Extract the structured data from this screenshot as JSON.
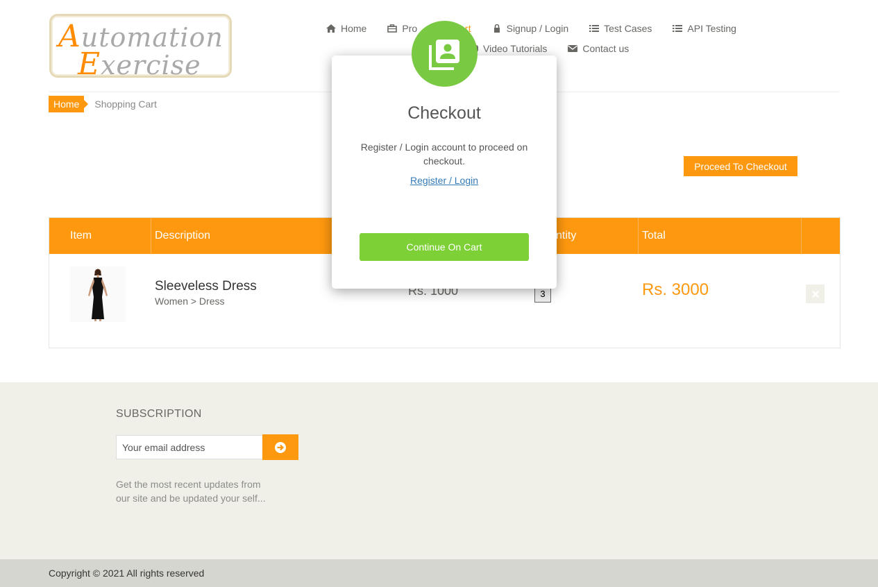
{
  "logo": {
    "line1_cap": "A",
    "line1_rest": "utomation",
    "line2_cap": "E",
    "line2_rest": "xercise"
  },
  "nav": {
    "row1": [
      {
        "label": "Home",
        "icon": "home-icon"
      },
      {
        "label": "Pro",
        "icon": "products-icon"
      },
      {
        "label": "Cart",
        "icon": "cart-icon"
      },
      {
        "label": "Signup / Login",
        "icon": "lock-icon"
      },
      {
        "label": "Test Cases",
        "icon": "list-icon"
      },
      {
        "label": "API Testing",
        "icon": "list-icon"
      }
    ],
    "row2": [
      {
        "label": "Video Tutorials",
        "icon": "youtube-icon"
      },
      {
        "label": "Contact us",
        "icon": "envelope-icon"
      }
    ]
  },
  "breadcrumb": {
    "home": "Home",
    "current": "Shopping Cart"
  },
  "proceed_label": "Proceed To Checkout",
  "cart": {
    "headers": {
      "item": "Item",
      "description": "Description",
      "quantity": "ntity",
      "total": "Total"
    },
    "row": {
      "name": "Sleeveless Dress",
      "category": "Women > Dress",
      "price": "Rs. 1000",
      "quantity": "3",
      "total": "Rs. 3000"
    }
  },
  "footer": {
    "subscription_title": "SUBSCRIPTION",
    "email_placeholder": "Your email address",
    "subscription_text": "Get the most recent updates from our site and be updated your self...",
    "copyright": "Copyright © 2021 All rights reserved"
  },
  "modal": {
    "title": "Checkout",
    "text": "Register / Login account to proceed on checkout.",
    "link": "Register / Login",
    "button": "Continue On Cart"
  },
  "colors": {
    "accent": "#fe980f",
    "modal_green": "#7ac943",
    "footer_bg": "#f0f0e9"
  }
}
